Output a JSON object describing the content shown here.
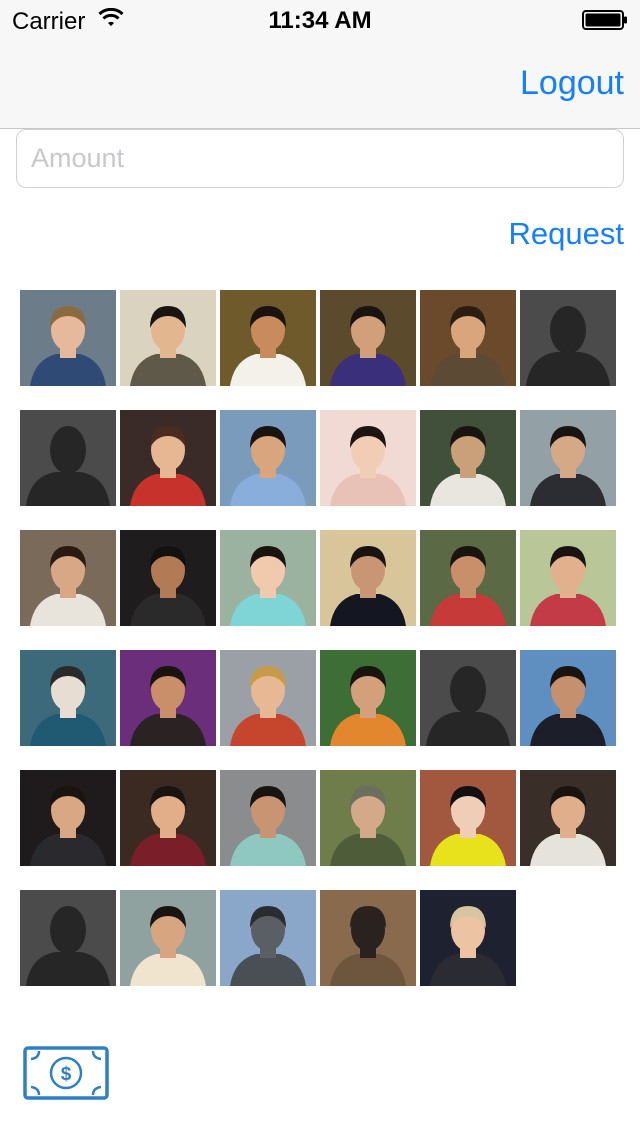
{
  "status_bar": {
    "carrier": "Carrier",
    "time": "11:34 AM"
  },
  "nav": {
    "logout_label": "Logout"
  },
  "amount_field": {
    "placeholder": "Amount",
    "value": ""
  },
  "request_label": "Request",
  "colors": {
    "accent": "#157efb",
    "nav_background": "#f7f7f7"
  },
  "friends": [
    {
      "kind": "photo",
      "bg": "#6c7c88",
      "skin": "#e6b99c",
      "hair": "#8a6a3f",
      "shirt": "#2f4a74"
    },
    {
      "kind": "photo",
      "bg": "#d9d3c0",
      "skin": "#e2b68f",
      "hair": "#1a1410",
      "shirt": "#5e5948"
    },
    {
      "kind": "photo",
      "bg": "#6e5a2a",
      "skin": "#c98b5d",
      "hair": "#1a1410",
      "shirt": "#f3f1ea"
    },
    {
      "kind": "photo",
      "bg": "#5b4a2c",
      "skin": "#d1a07a",
      "hair": "#1a1410",
      "shirt": "#3a2f7a"
    },
    {
      "kind": "photo",
      "bg": "#6a4a2a",
      "skin": "#d8a57c",
      "hair": "#2a1d12",
      "shirt": "#5d4a34"
    },
    {
      "kind": "placeholder"
    },
    {
      "kind": "placeholder"
    },
    {
      "kind": "photo",
      "bg": "#3a2a28",
      "skin": "#e7b794",
      "hair": "#4a2d1e",
      "shirt": "#c7322c"
    },
    {
      "kind": "photo",
      "bg": "#7b9bbd",
      "skin": "#d9a57d",
      "hair": "#1a1410",
      "shirt": "#8aaedb"
    },
    {
      "kind": "photo",
      "bg": "#f1d9d4",
      "skin": "#f2cdb6",
      "hair": "#1d1512",
      "shirt": "#e8c1b7"
    },
    {
      "kind": "photo",
      "bg": "#41503a",
      "skin": "#caa07b",
      "hair": "#1a1410",
      "shirt": "#e8e6df"
    },
    {
      "kind": "photo",
      "bg": "#93a0a6",
      "skin": "#d6a986",
      "hair": "#1a1410",
      "shirt": "#2b2d33"
    },
    {
      "kind": "photo",
      "bg": "#7a6a5a",
      "skin": "#d8a886",
      "hair": "#2a1a12",
      "shirt": "#e8e4dc"
    },
    {
      "kind": "photo",
      "bg": "#1f1c1d",
      "skin": "#b37a56",
      "hair": "#111111",
      "shirt": "#2a2a2a"
    },
    {
      "kind": "photo",
      "bg": "#9cb2a0",
      "skin": "#f1c9ad",
      "hair": "#1a1410",
      "shirt": "#7fd4d6"
    },
    {
      "kind": "photo",
      "bg": "#d8c59a",
      "skin": "#c99675",
      "hair": "#1a1410",
      "shirt": "#141722"
    },
    {
      "kind": "photo",
      "bg": "#5b6a45",
      "skin": "#c98e6a",
      "hair": "#1a1410",
      "shirt": "#c63a3a"
    },
    {
      "kind": "photo",
      "bg": "#b8c698",
      "skin": "#e3b08d",
      "hair": "#1a1410",
      "shirt": "#c23b47"
    },
    {
      "kind": "photo",
      "bg": "#3d6a7a",
      "skin": "#e8ddd2",
      "hair": "#2a2a2a",
      "shirt": "#1f5a72"
    },
    {
      "kind": "photo",
      "bg": "#6a2e7a",
      "skin": "#c98e6a",
      "hair": "#1a1410",
      "shirt": "#2b2224"
    },
    {
      "kind": "photo",
      "bg": "#9aa0a6",
      "skin": "#e7b893",
      "hair": "#c69a4a",
      "shirt": "#c5462d"
    },
    {
      "kind": "photo",
      "bg": "#3c6e36",
      "skin": "#d4a07c",
      "hair": "#1a1410",
      "shirt": "#e2872d"
    },
    {
      "kind": "placeholder"
    },
    {
      "kind": "photo",
      "bg": "#5f8fc0",
      "skin": "#c4906e",
      "hair": "#1a1410",
      "shirt": "#1c1f2a"
    },
    {
      "kind": "photo",
      "bg": "#1f1a1c",
      "skin": "#d9a783",
      "hair": "#1a1410",
      "shirt": "#2a2a2e"
    },
    {
      "kind": "photo",
      "bg": "#3b2a22",
      "skin": "#e2ae89",
      "hair": "#1a1410",
      "shirt": "#7a1f2a"
    },
    {
      "kind": "photo",
      "bg": "#8a8c8e",
      "skin": "#c99472",
      "hair": "#1a1410",
      "shirt": "#8fc7c1"
    },
    {
      "kind": "photo",
      "bg": "#6f7d4a",
      "skin": "#d4a98a",
      "hair": "#6a6f5e",
      "shirt": "#4f5c3a"
    },
    {
      "kind": "photo",
      "bg": "#a2583e",
      "skin": "#f0cdb7",
      "hair": "#121010",
      "shirt": "#e7e21c"
    },
    {
      "kind": "photo",
      "bg": "#3a2e28",
      "skin": "#e0ae8a",
      "hair": "#1a1410",
      "shirt": "#e6e2dc"
    },
    {
      "kind": "placeholder"
    },
    {
      "kind": "photo",
      "bg": "#8fa2a0",
      "skin": "#d7a680",
      "hair": "#1a1410",
      "shirt": "#f1e4cf"
    },
    {
      "kind": "photo",
      "bg": "#8aa7c9",
      "skin": "#5a5f66",
      "hair": "#2a2d30",
      "shirt": "#4a4f56"
    },
    {
      "kind": "photo",
      "bg": "#8a6a4c",
      "skin": "#2a221e",
      "hair": "#2a221e",
      "shirt": "#6e553e"
    },
    {
      "kind": "photo",
      "bg": "#1e2230",
      "skin": "#ecc3a3",
      "hair": "#d7c5a0",
      "shirt": "#2b2b33"
    }
  ],
  "pay_icon": "dollar-bill-icon"
}
